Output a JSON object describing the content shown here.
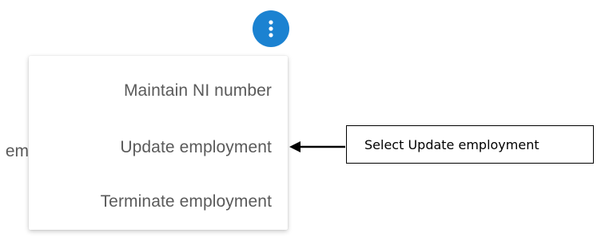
{
  "more_actions": {
    "icon": "more-vertical-icon",
    "color": "#1b82d1"
  },
  "background_partial_text": "em",
  "menu": {
    "items": [
      {
        "label": "Maintain NI number"
      },
      {
        "label": "Update employment"
      },
      {
        "label": "Terminate employment"
      }
    ]
  },
  "annotation": {
    "text": "Select Update employment",
    "arrow_icon": "arrow-left-icon"
  }
}
